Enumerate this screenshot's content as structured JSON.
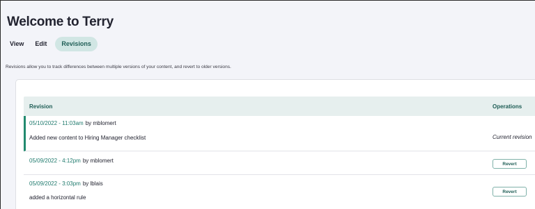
{
  "page": {
    "title": "Welcome to Terry",
    "tabs": [
      {
        "label": "View"
      },
      {
        "label": "Edit"
      },
      {
        "label": "Revisions",
        "active": true
      }
    ],
    "help_text": "Revisions allow you to track differences between multiple versions of your content, and revert to older versions."
  },
  "table": {
    "headers": {
      "revision": "Revision",
      "operations": "Operations"
    },
    "rows": [
      {
        "date": "05/10/2022 - 11:03am",
        "by": "by mblomert",
        "message": "Added new content to Hiring Manager checklist",
        "operation": "Current revision",
        "current": true
      },
      {
        "date": "05/09/2022 - 4:12pm",
        "by": "by mblomert",
        "message": "",
        "operation": "Revert",
        "current": false
      },
      {
        "date": "05/09/2022 - 3:03pm",
        "by": "by lblais",
        "message": "added a horizontal rule",
        "operation": "Revert",
        "current": false
      }
    ]
  },
  "colors": {
    "accent": "#228a6f",
    "link": "#1f7a6d",
    "header_bg": "#e6efee",
    "active_tab_bg": "#d1e6e4"
  }
}
